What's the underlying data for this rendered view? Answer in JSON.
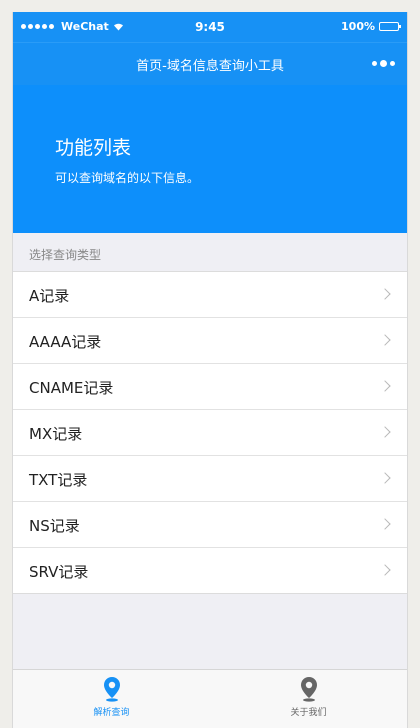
{
  "status_bar": {
    "carrier": "WeChat",
    "time": "9:45",
    "battery": "100%"
  },
  "nav": {
    "title": "首页-域名信息查询小工具"
  },
  "hero": {
    "title": "功能列表",
    "description": "可以查询域名的以下信息。"
  },
  "section": {
    "label": "选择查询类型"
  },
  "records": [
    {
      "label": "A记录"
    },
    {
      "label": "AAAA记录"
    },
    {
      "label": "CNAME记录"
    },
    {
      "label": "MX记录"
    },
    {
      "label": "TXT记录"
    },
    {
      "label": "NS记录"
    },
    {
      "label": "SRV记录"
    }
  ],
  "tabs": [
    {
      "label": "解析查询",
      "icon": "location-pin-icon",
      "active": true,
      "color": "#1791f5"
    },
    {
      "label": "关于我们",
      "icon": "location-pin-icon",
      "active": false,
      "color": "#666666"
    }
  ],
  "colors": {
    "brand": "#1791f5",
    "hero": "#0d8ffb"
  }
}
